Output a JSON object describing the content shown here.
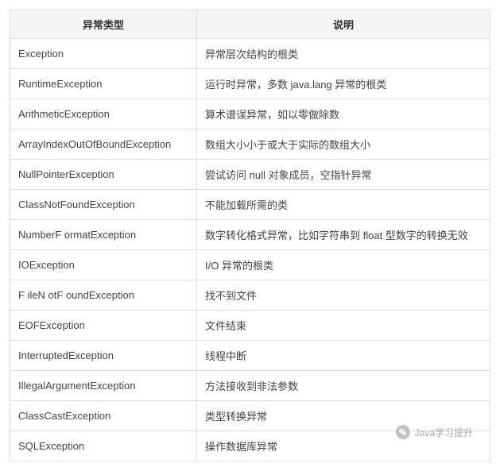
{
  "table": {
    "headers": {
      "col1": "异常类型",
      "col2": "说明"
    },
    "rows": [
      {
        "type": "Exception",
        "desc": "异常层次结构的根类"
      },
      {
        "type": "RuntimeException",
        "desc": "运行时异常，多数 java.lang 异常的根类"
      },
      {
        "type": "ArithmeticException",
        "desc": "算术谱误异常，如以零做除数"
      },
      {
        "type": "ArrayIndexOutOfBoundException",
        "desc": "数组大小小于或大于实际的数组大小"
      },
      {
        "type": "NullPointerException",
        "desc": "尝试访问 null 对象成员，空指针异常"
      },
      {
        "type": "ClassNotFoundException",
        "desc": "不能加载所需的类"
      },
      {
        "type": "NumberF ormatException",
        "desc": "数字转化格式异常，比如字符串到 float 型数字的转换无效"
      },
      {
        "type": "IOException",
        "desc": "I/O 异常的根类"
      },
      {
        "type": "F ileN otF oundException",
        "desc": "找不到文件"
      },
      {
        "type": "EOFException",
        "desc": "文件结束"
      },
      {
        "type": "InterruptedException",
        "desc": "线程中断"
      },
      {
        "type": "IllegalArgumentException",
        "desc": "方法接收到非法参数"
      },
      {
        "type": "ClassCastException",
        "desc": "类型转换异常"
      },
      {
        "type": "SQLException",
        "desc": "操作数据库异常"
      }
    ]
  },
  "watermark": {
    "text": "Java学习提升"
  }
}
